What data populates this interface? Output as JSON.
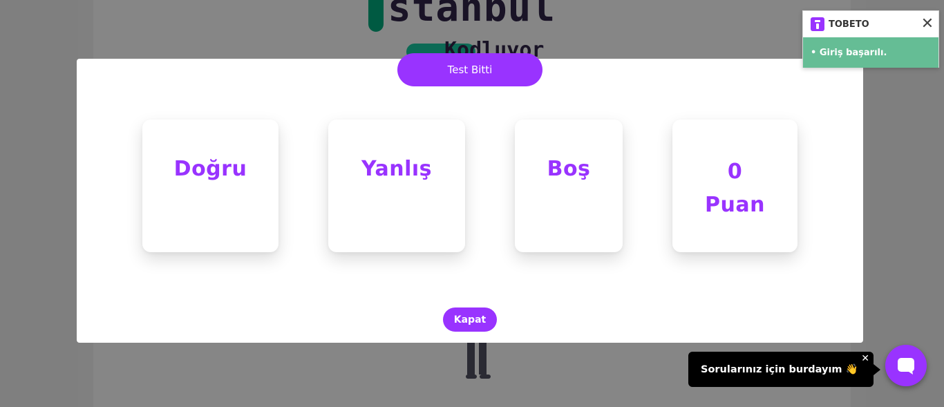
{
  "background": {
    "logo_word1": "stanbul",
    "logo_word2": "Kodluyor"
  },
  "modal": {
    "header_button": "Test Bitti",
    "cards": {
      "correct_label": "Doğru",
      "wrong_label": "Yanlış",
      "empty_label": "Boş",
      "score_value": "0",
      "score_label": "Puan"
    },
    "close_button": "Kapat"
  },
  "toast": {
    "title": "TOBETO",
    "message": "• Giriş başarılı.",
    "close_glyph": "✕"
  },
  "chat": {
    "message": "Sorularınız için burdayım 👋",
    "close_glyph": "✕"
  },
  "colors": {
    "accent": "#9933ff",
    "toast_success": "#65bd95",
    "overlay": "#7f7f7f"
  }
}
